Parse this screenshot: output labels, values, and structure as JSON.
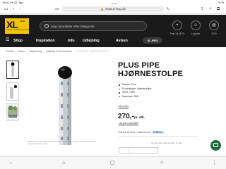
{
  "status_bar": {
    "time": "15:41",
    "date": "Fri 22. Apr",
    "battery": "70 %"
  },
  "browser": {
    "url": "www.xl-byg.dk",
    "icons": [
      "sidebar-icon",
      "back-icon",
      "forward-icon",
      "text-size-icon",
      "lock-icon",
      "reload-icon",
      "share-icon",
      "add-tab-icon",
      "tabs-icon"
    ]
  },
  "header": {
    "logo": {
      "main": "XL",
      "sub": "BYG",
      "tagline": "GØR DET NEMMERE AT BYGGE"
    },
    "search_placeholder": "Søg i produkter eller kategorier",
    "store_label": "Find XL-BYG",
    "account_label": "Log ind",
    "cart_label": "0,00"
  },
  "nav": {
    "items": [
      "Shop",
      "Inspiration",
      "Info",
      "Udlejning",
      "Avisen"
    ],
    "xlpro": "XL-PRO"
  },
  "breadcrumb": [
    "Forside",
    "Haven",
    "Beplantning",
    "Højbede & Plantekasser",
    "PLUS PIPE HJØRNESTOLPE"
  ],
  "product": {
    "title": "PLUS PIPE HJØRNESTOLPE",
    "specs": [
      "Mærke: Plus",
      "Produkttype: Hjørnestolpe",
      "Serie: PIPE",
      "Materiale: Stål"
    ],
    "more_link": "Mere info",
    "price": "270,-",
    "per_unit": "pr. stk.",
    "price_note": "Lav pris i varehuset",
    "stock_text": "Pris fra: 27,00 kr. / Vederdi med",
    "stock_badge": "VAREALL",
    "secondary_text": "Info af antal: Hjørnestolpe (1 stk.)",
    "image_caption": "Billedet kan indeholde produkter der ikke er inkluderet i prisen. Set forside produktet der er inkluderet i prisen."
  },
  "colors": {
    "header_bg": "#1a1a1a",
    "logo_yellow": "#f2c400",
    "chat_green": "#1f6d3f"
  }
}
